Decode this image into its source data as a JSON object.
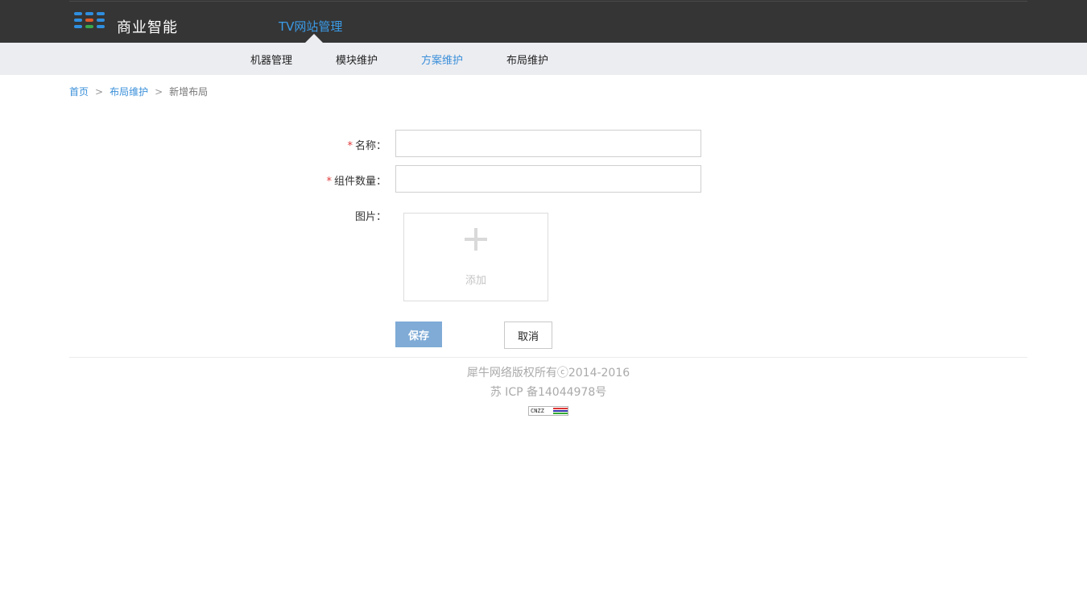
{
  "header": {
    "brand": "商业智能",
    "product": "TV网站管理",
    "logo_icon": "grid-dots-icon"
  },
  "subnav": {
    "items": [
      {
        "label": "机器管理"
      },
      {
        "label": "模块维护"
      },
      {
        "label": "方案维护",
        "active": true
      },
      {
        "label": "布局维护"
      }
    ]
  },
  "breadcrumb": {
    "home": "首页",
    "separator": ">",
    "parent": "布局维护",
    "current": "新增布局"
  },
  "form": {
    "required_mark": "*",
    "name_label": "名称：",
    "name_value": "",
    "count_label": "组件数量：",
    "count_value": "",
    "image_label": "图片：",
    "upload_label": "添加"
  },
  "actions": {
    "save_label": "保存",
    "cancel_label": "取消"
  },
  "footer": {
    "copyright": "犀牛网络版权所有ⓒ2014-2016",
    "icp": "苏 ICP 备14044978号",
    "badge_text": "CNZZ"
  },
  "colors": {
    "topbar": "#353535",
    "accent": "#3a8fd9",
    "save_button": "#7fabd6",
    "required": "#e03a3a"
  }
}
